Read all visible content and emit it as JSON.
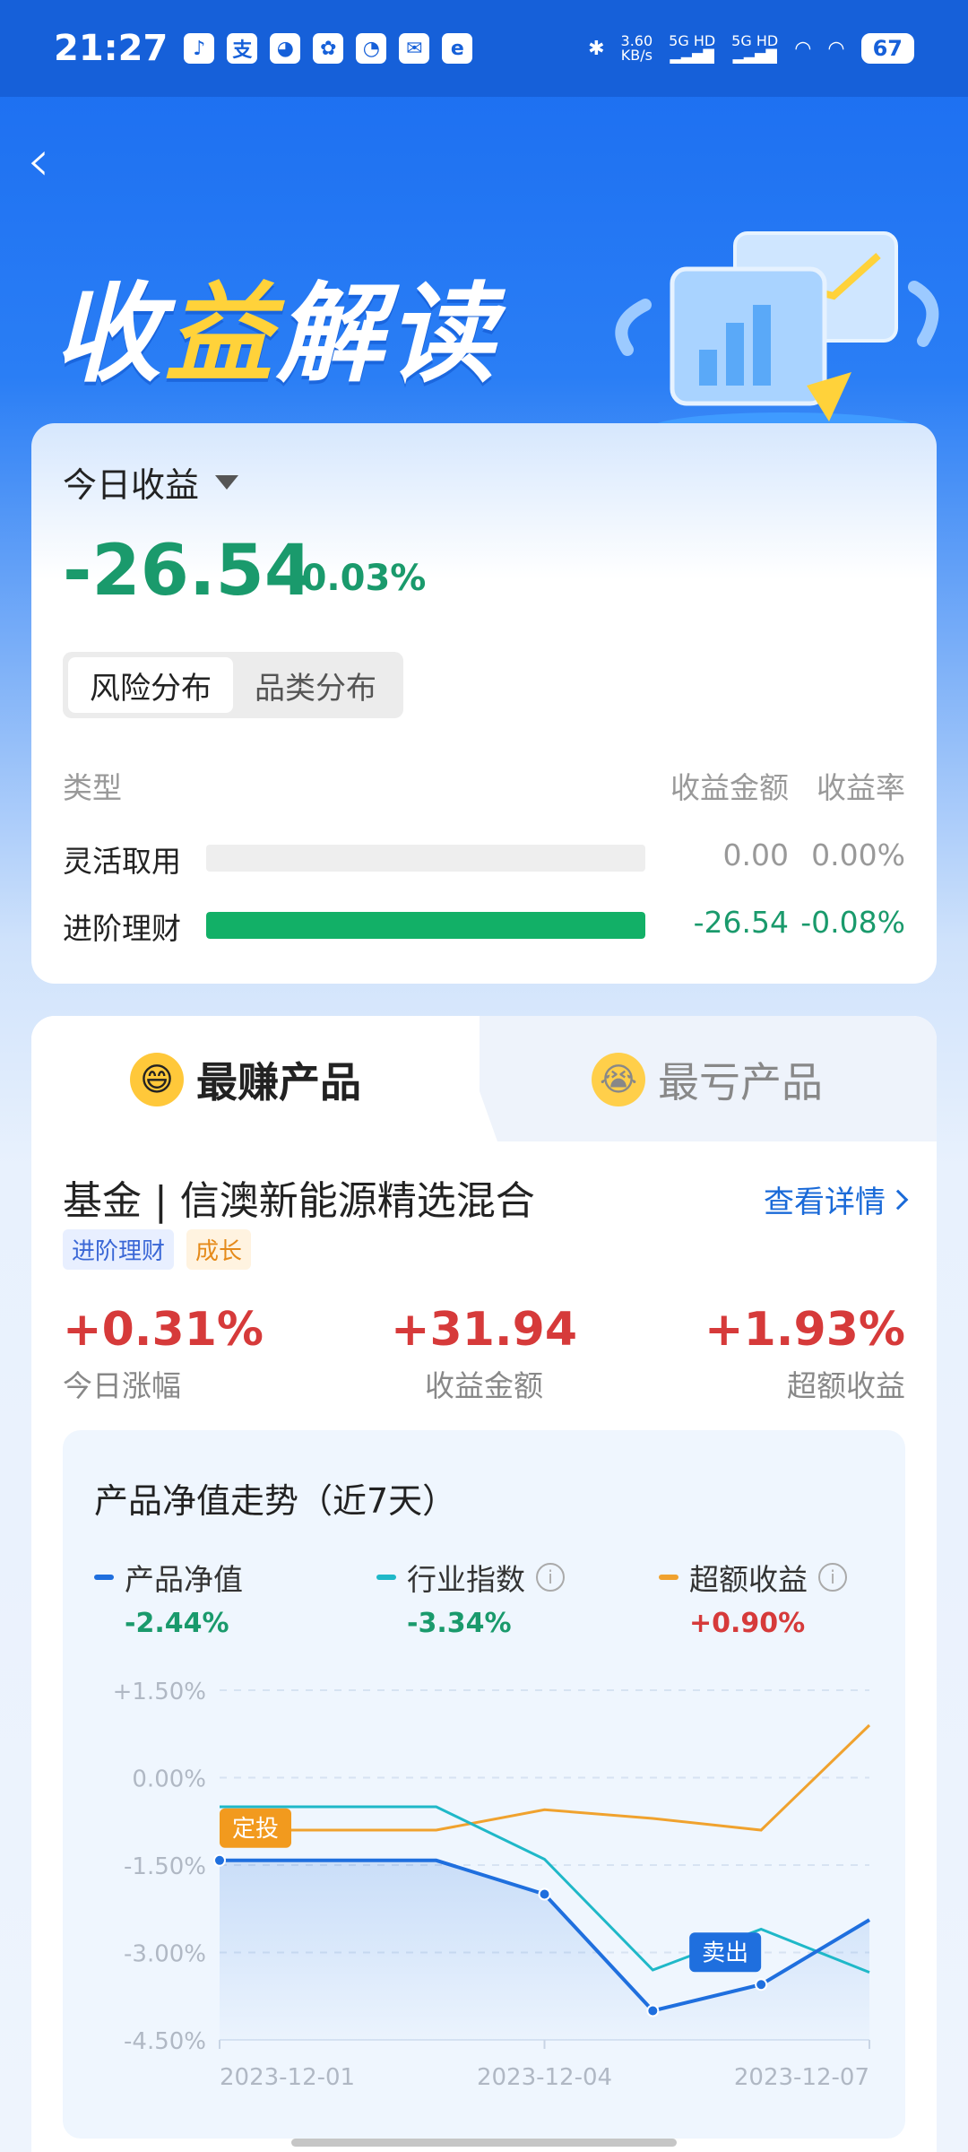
{
  "status_bar": {
    "time": "21:27",
    "apps": [
      "tiktok-icon",
      "alipay-icon",
      "app-icon",
      "app-icon",
      "app-icon",
      "app-icon",
      "app-icon"
    ],
    "net_speed_value": "3.60",
    "net_speed_unit": "KB/s",
    "signal1": "5G HD",
    "signal2": "5G HD",
    "battery": "67"
  },
  "header": {
    "back_icon": "chevron-left-icon",
    "title_a": "收",
    "title_b": "益",
    "title_c": "解读"
  },
  "summary": {
    "label": "今日收益",
    "amount": "-26.54",
    "rate": "-0.03%",
    "tabs": [
      "风险分布",
      "品类分布"
    ],
    "columns": [
      "类型",
      "收益金额",
      "收益率"
    ],
    "rows": [
      {
        "name": "灵活取用",
        "fill": 0,
        "amount": "0.00",
        "rate": "0.00%"
      },
      {
        "name": "进阶理财",
        "fill": 1,
        "amount": "-26.54",
        "rate": "-0.08%"
      }
    ],
    "colors": {
      "negative": "#1a9a6c",
      "neutral": "#999999",
      "bar": "#12b067"
    }
  },
  "products": {
    "tab_best": "最赚产品",
    "tab_worst": "最亏产品",
    "fund_name": "基金 | 信澳新能源精选混合",
    "detail_link": "查看详情",
    "tags": [
      "进阶理财",
      "成长"
    ],
    "metrics": [
      {
        "value": "+0.31%",
        "label": "今日涨幅"
      },
      {
        "value": "+31.94",
        "label": "收益金额"
      },
      {
        "value": "+1.93%",
        "label": "超额收益"
      }
    ]
  },
  "chart_data": {
    "type": "line",
    "title": "产品净值走势（近7天）",
    "x": [
      "2023-12-01",
      "2023-12-02",
      "2023-12-03",
      "2023-12-04",
      "2023-12-05",
      "2023-12-06",
      "2023-12-07"
    ],
    "x_tick_labels": [
      "2023-12-01",
      "2023-12-04",
      "2023-12-07"
    ],
    "y_tick_labels": [
      "+1.50%",
      "0.00%",
      "-1.50%",
      "-3.00%",
      "-4.50%"
    ],
    "ylim": [
      -4.5,
      1.5
    ],
    "series": [
      {
        "name": "产品净值",
        "summary": "-2.44%",
        "color": "#1f6fde",
        "values": [
          -1.42,
          -1.42,
          -1.42,
          -2.0,
          -4.0,
          -3.55,
          -2.44
        ]
      },
      {
        "name": "行业指数",
        "summary": "-3.34%",
        "color": "#1fb8c8",
        "values": [
          -0.5,
          -0.5,
          -0.5,
          -1.4,
          -3.3,
          -2.6,
          -3.34
        ]
      },
      {
        "name": "超额收益",
        "summary": "+0.90%",
        "color": "#f0a22e",
        "values": [
          -0.9,
          -0.9,
          -0.9,
          -0.55,
          -0.7,
          -0.9,
          0.9
        ]
      }
    ],
    "annotations": [
      {
        "label": "定投",
        "x_index": 0,
        "series": 0,
        "color": "#f29a1e"
      },
      {
        "label": "卖出",
        "x_index": 5,
        "series": 0,
        "color": "#1f6fde"
      }
    ],
    "legend_placement": "top",
    "grid": true
  }
}
